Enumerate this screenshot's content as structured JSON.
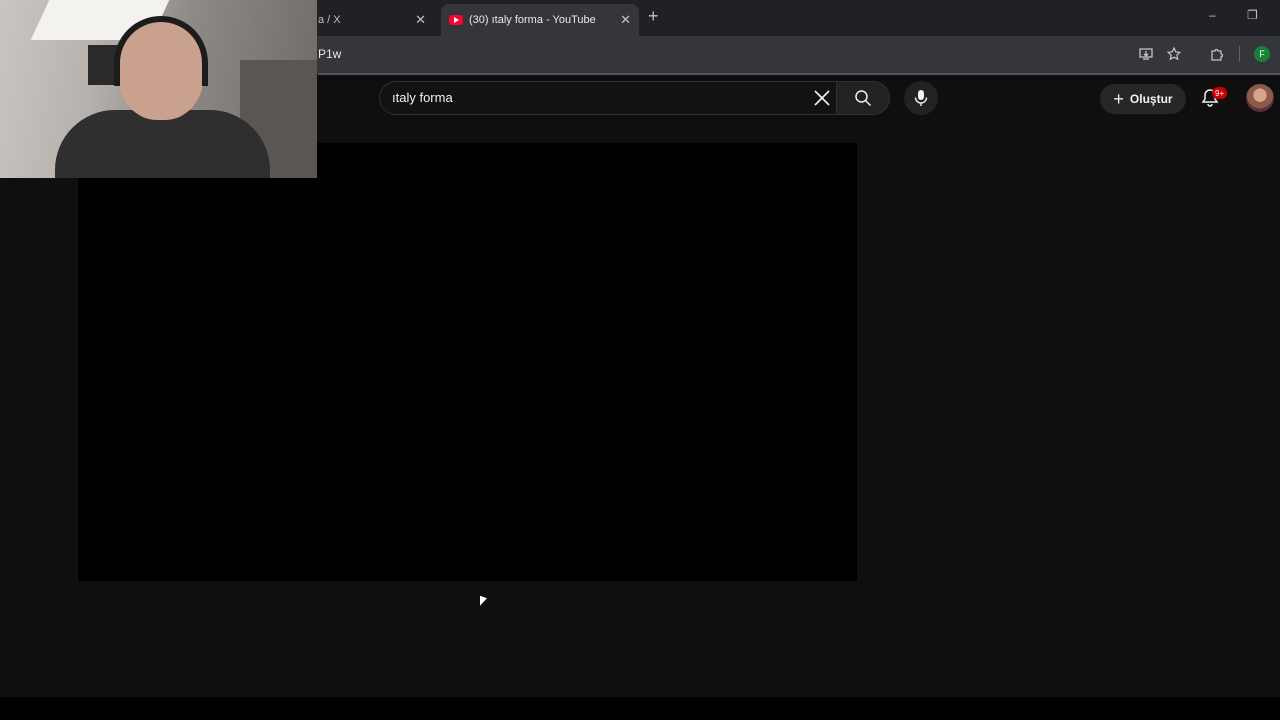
{
  "browser": {
    "tabs": [
      {
        "title": "a / X",
        "active": false
      },
      {
        "title": "(30) ıtaly forma - YouTube",
        "active": true
      }
    ],
    "new_tab_symbol": "+",
    "close_symbol": "✕",
    "url": "P1w",
    "profile_initial": "F",
    "window_controls": {
      "minimize": "–",
      "restore": "❐"
    }
  },
  "youtube": {
    "search": {
      "value": "ıtaly forma"
    },
    "create_label": "Oluştur",
    "notifications_count": "9+"
  },
  "colors": {
    "yt_red": "#ff0033",
    "badge_red": "#cc0000",
    "profile_green": "#188038",
    "background": "#0f0f0f"
  },
  "icons": [
    "youtube-favicon",
    "close-icon",
    "new-tab-icon",
    "install-app-icon",
    "star-icon",
    "extensions-icon",
    "clear-icon",
    "search-icon",
    "mic-icon",
    "plus-icon",
    "bell-icon"
  ]
}
